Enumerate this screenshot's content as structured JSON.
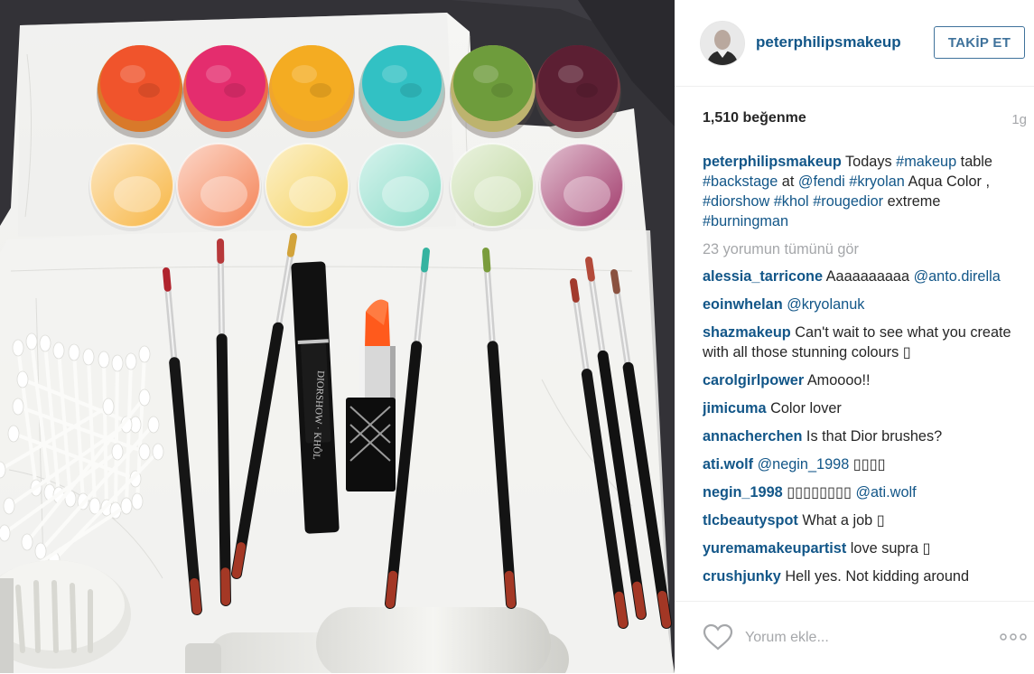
{
  "post": {
    "username": "peterphilipsmakeup",
    "follow_label": "TAKİP ET",
    "likes": "1,510 beğenme",
    "time": "1g",
    "caption_parts": [
      {
        "text": "peterphilipsmakeup",
        "type": "user"
      },
      {
        "text": " Todays ",
        "type": "text"
      },
      {
        "text": "#makeup",
        "type": "tag"
      },
      {
        "text": " table ",
        "type": "text"
      },
      {
        "text": "#backstage",
        "type": "tag"
      },
      {
        "text": " at ",
        "type": "text"
      },
      {
        "text": "@fendi",
        "type": "tag"
      },
      {
        "text": " ",
        "type": "text"
      },
      {
        "text": "#kryolan",
        "type": "tag"
      },
      {
        "text": " Aqua Color , ",
        "type": "text"
      },
      {
        "text": "#diorshow",
        "type": "tag"
      },
      {
        "text": " ",
        "type": "text"
      },
      {
        "text": "#khol",
        "type": "tag"
      },
      {
        "text": " ",
        "type": "text"
      },
      {
        "text": "#rougedior",
        "type": "tag"
      },
      {
        "text": " extreme ",
        "type": "text"
      },
      {
        "text": "#burningman",
        "type": "tag"
      }
    ],
    "view_all": "23 yorumun tümünü gör",
    "comments": [
      {
        "user": "alessia_tarricone",
        "parts": [
          {
            "text": " Aaaaaaaaaa ",
            "type": "text"
          },
          {
            "text": "@anto.dirella",
            "type": "tag"
          }
        ]
      },
      {
        "user": "eoinwhelan",
        "parts": [
          {
            "text": " ",
            "type": "text"
          },
          {
            "text": "@kryolanuk",
            "type": "tag"
          }
        ]
      },
      {
        "user": "shazmakeup",
        "parts": [
          {
            "text": " Can't wait to see what you create with all those stunning colours ▯",
            "type": "text"
          }
        ]
      },
      {
        "user": "carolgirlpower",
        "parts": [
          {
            "text": " Amoooo!!",
            "type": "text"
          }
        ]
      },
      {
        "user": "jimicuma",
        "parts": [
          {
            "text": " Color lover",
            "type": "text"
          }
        ]
      },
      {
        "user": "annacherchen",
        "parts": [
          {
            "text": " Is that Dior brushes?",
            "type": "text"
          }
        ]
      },
      {
        "user": "ati.wolf",
        "parts": [
          {
            "text": " ",
            "type": "text"
          },
          {
            "text": "@negin_1998",
            "type": "tag"
          },
          {
            "text": " ▯▯▯▯",
            "type": "text"
          }
        ]
      },
      {
        "user": "negin_1998",
        "parts": [
          {
            "text": " ▯▯▯▯▯▯▯▯ ",
            "type": "text"
          },
          {
            "text": "@ati.wolf",
            "type": "tag"
          }
        ]
      },
      {
        "user": "tlcbeautyspot",
        "parts": [
          {
            "text": " What a job ▯",
            "type": "text"
          }
        ]
      },
      {
        "user": "yuremamakeupartist",
        "parts": [
          {
            "text": " love supra ▯",
            "type": "text"
          }
        ]
      },
      {
        "user": "crushjunky",
        "parts": [
          {
            "text": " Hell yes. Not kidding around",
            "type": "text"
          }
        ]
      }
    ],
    "add_comment_placeholder": "Yorum ekle...",
    "icons": {
      "like": "heart-icon",
      "more": "more-options-icon"
    }
  },
  "photo": {
    "pot_colors_top": [
      "#f0542c",
      "#e42d6e",
      "#f4ac22",
      "#32c1c4",
      "#6e9c3c",
      "#5c1f33"
    ],
    "pot_colors_bottom": [
      "#f7b23a",
      "#f47d4e",
      "#f5cf52",
      "#7fd9c4",
      "#bcd69a",
      "#9c2f63"
    ],
    "pot_lids_top": [
      "#d9792a",
      "#ea6d4a",
      "#f0a52d",
      "#a9c8c2",
      "#bdb36e",
      "#7b3a46"
    ],
    "lipstick_color": "#ff5a1c"
  }
}
